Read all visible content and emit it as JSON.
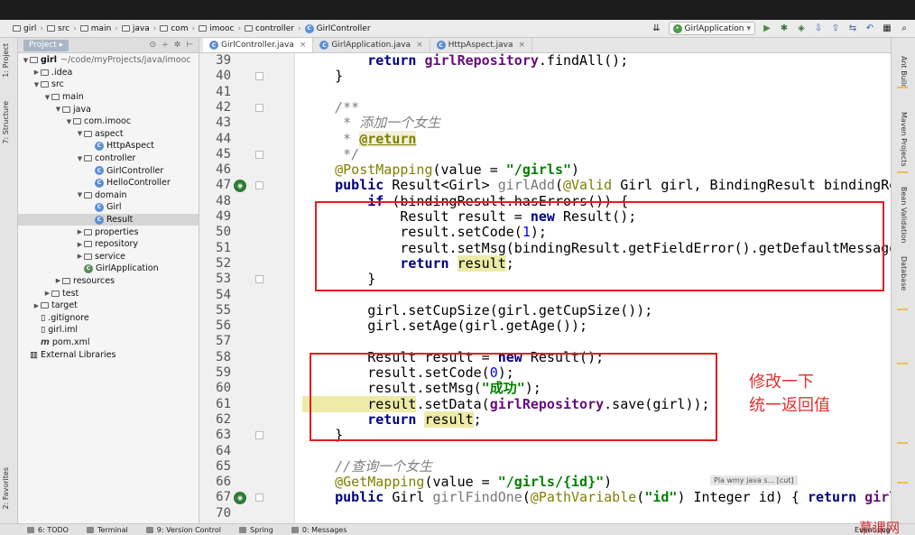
{
  "breadcrumb": [
    "girl",
    "src",
    "main",
    "java",
    "com",
    "imooc",
    "controller",
    "GirlController"
  ],
  "run_config": "GirlApplication",
  "project_panel": {
    "tab_label": "Project",
    "root_name": "girl",
    "root_path": "~/code/myProjects/java/imooc",
    "tree": [
      {
        "label": "girl",
        "type": "folder",
        "indent": 0
      },
      {
        "label": ".idea",
        "type": "folder",
        "indent": 1
      },
      {
        "label": "src",
        "type": "folder",
        "indent": 1
      },
      {
        "label": "main",
        "type": "folder",
        "indent": 2
      },
      {
        "label": "java",
        "type": "folder",
        "indent": 3
      },
      {
        "label": "com.imooc",
        "type": "package",
        "indent": 4
      },
      {
        "label": "aspect",
        "type": "package",
        "indent": 5
      },
      {
        "label": "HttpAspect",
        "type": "class",
        "indent": 6
      },
      {
        "label": "controller",
        "type": "package",
        "indent": 5
      },
      {
        "label": "GirlController",
        "type": "class",
        "indent": 6
      },
      {
        "label": "HelloController",
        "type": "class",
        "indent": 6
      },
      {
        "label": "domain",
        "type": "package",
        "indent": 5
      },
      {
        "label": "Girl",
        "type": "class",
        "indent": 6
      },
      {
        "label": "Result",
        "type": "class",
        "indent": 6,
        "selected": true
      },
      {
        "label": "properties",
        "type": "package",
        "indent": 5
      },
      {
        "label": "repository",
        "type": "package",
        "indent": 5
      },
      {
        "label": "service",
        "type": "package",
        "indent": 5
      },
      {
        "label": "GirlApplication",
        "type": "app",
        "indent": 5
      },
      {
        "label": "resources",
        "type": "folder",
        "indent": 3
      },
      {
        "label": "test",
        "type": "folder",
        "indent": 2
      },
      {
        "label": "target",
        "type": "folder",
        "indent": 1
      },
      {
        "label": ".gitignore",
        "type": "file",
        "indent": 1
      },
      {
        "label": "girl.iml",
        "type": "file",
        "indent": 1
      },
      {
        "label": "pom.xml",
        "type": "maven",
        "indent": 1
      },
      {
        "label": "External Libraries",
        "type": "lib",
        "indent": 0
      }
    ]
  },
  "editor_tabs": [
    {
      "label": "GirlController.java",
      "active": true
    },
    {
      "label": "GirlApplication.java",
      "active": false
    },
    {
      "label": "HttpAspect.java",
      "active": false
    }
  ],
  "code_lines": [
    {
      "n": "39",
      "tokens": [
        [
          "",
          "        "
        ],
        [
          "kw",
          "return "
        ],
        [
          "field",
          "girlRepository"
        ],
        [
          "",
          ".findAll();"
        ]
      ]
    },
    {
      "n": "40",
      "tokens": [
        [
          "",
          "    }"
        ]
      ]
    },
    {
      "n": "41",
      "tokens": [
        [
          "",
          ""
        ]
      ]
    },
    {
      "n": "42",
      "tokens": [
        [
          "comment",
          "    /**"
        ]
      ]
    },
    {
      "n": "43",
      "tokens": [
        [
          "comment",
          "     * 添加一个女生"
        ]
      ]
    },
    {
      "n": "44",
      "tokens": [
        [
          "comment",
          "     * "
        ],
        [
          "doc-tag",
          "@return"
        ]
      ]
    },
    {
      "n": "45",
      "tokens": [
        [
          "comment",
          "     */"
        ]
      ]
    },
    {
      "n": "46",
      "tokens": [
        [
          "ann",
          "    @PostMapping"
        ],
        [
          "",
          "(value = "
        ],
        [
          "str",
          "\"/girls\""
        ],
        [
          "",
          ")"
        ]
      ]
    },
    {
      "n": "47",
      "tokens": [
        [
          "kw",
          "    public "
        ],
        [
          "",
          "Result<Girl> "
        ],
        [
          "param",
          "girlAdd"
        ],
        [
          "",
          "("
        ],
        [
          "ann",
          "@Valid "
        ],
        [
          "",
          "Girl girl, BindingResult bindingResu"
        ]
      ]
    },
    {
      "n": "48",
      "tokens": [
        [
          "",
          "        "
        ],
        [
          "kw",
          "if "
        ],
        [
          "",
          "(bindingResult.hasErrors()) {"
        ]
      ]
    },
    {
      "n": "49",
      "tokens": [
        [
          "",
          "            Result result = "
        ],
        [
          "kw",
          "new "
        ],
        [
          "",
          "Result();"
        ]
      ]
    },
    {
      "n": "50",
      "tokens": [
        [
          "",
          "            result.setCode("
        ],
        [
          "num",
          "1"
        ],
        [
          "",
          ");"
        ]
      ]
    },
    {
      "n": "51",
      "tokens": [
        [
          "",
          "            result.setMsg(bindingResult.getFieldError().getDefaultMessage("
        ]
      ]
    },
    {
      "n": "52",
      "tokens": [
        [
          "",
          "            "
        ],
        [
          "kw",
          "return "
        ],
        [
          "hl",
          "result"
        ],
        [
          "",
          ";"
        ]
      ]
    },
    {
      "n": "53",
      "tokens": [
        [
          "",
          "        }"
        ]
      ]
    },
    {
      "n": "54",
      "tokens": [
        [
          "",
          ""
        ]
      ]
    },
    {
      "n": "55",
      "tokens": [
        [
          "",
          "        girl.setCupSize(girl.getCupSize());"
        ]
      ]
    },
    {
      "n": "56",
      "tokens": [
        [
          "",
          "        girl.setAge(girl.getAge());"
        ]
      ]
    },
    {
      "n": "57",
      "tokens": [
        [
          "",
          ""
        ]
      ]
    },
    {
      "n": "58",
      "tokens": [
        [
          "",
          "        Result result = "
        ],
        [
          "kw",
          "new "
        ],
        [
          "",
          "Result();"
        ]
      ]
    },
    {
      "n": "59",
      "tokens": [
        [
          "",
          "        result.setCode("
        ],
        [
          "num",
          "0"
        ],
        [
          "",
          ");"
        ]
      ]
    },
    {
      "n": "60",
      "tokens": [
        [
          "",
          "        result.setMsg("
        ],
        [
          "str",
          "\"成功\""
        ],
        [
          "",
          ");"
        ]
      ]
    },
    {
      "n": "61",
      "tokens": [
        [
          "hl",
          "        result"
        ],
        [
          "",
          ".setData("
        ],
        [
          "field",
          "girlRepository"
        ],
        [
          "",
          ".save(girl));"
        ]
      ]
    },
    {
      "n": "62",
      "tokens": [
        [
          "kw",
          "        return "
        ],
        [
          "hl",
          "result"
        ],
        [
          "",
          ";"
        ]
      ]
    },
    {
      "n": "63",
      "tokens": [
        [
          "",
          "    }"
        ]
      ]
    },
    {
      "n": "64",
      "tokens": [
        [
          "",
          ""
        ]
      ]
    },
    {
      "n": "65",
      "tokens": [
        [
          "comment",
          "    //查询一个女生"
        ]
      ]
    },
    {
      "n": "66",
      "tokens": [
        [
          "ann",
          "    @GetMapping"
        ],
        [
          "",
          "(value = "
        ],
        [
          "str",
          "\"/girls/{id}\""
        ],
        [
          "",
          ")"
        ]
      ]
    },
    {
      "n": "67",
      "tokens": [
        [
          "kw",
          "    public "
        ],
        [
          "",
          "Girl "
        ],
        [
          "param",
          "girlFindOne"
        ],
        [
          "",
          "("
        ],
        [
          "ann",
          "@PathVariable"
        ],
        [
          "",
          "("
        ],
        [
          "str",
          "\"id\""
        ],
        [
          "",
          ") Integer id) { "
        ],
        [
          "kw",
          "return "
        ],
        [
          "field",
          "girlR"
        ]
      ]
    },
    {
      "n": "70",
      "tokens": [
        [
          "",
          ""
        ]
      ]
    }
  ],
  "annotation_note": {
    "line1": "修改一下",
    "line2": "统一返回值"
  },
  "tooltip_text": "Pla wmy java s... [cut]",
  "left_tool_tabs": [
    "1: Project",
    "7: Structure",
    "2: Favorites"
  ],
  "right_tool_tabs": [
    "Ant Build",
    "Maven Projects",
    "Bean Validation",
    "Database"
  ],
  "status_items": [
    "6: TODO",
    "Terminal",
    "9: Version Control",
    "Spring",
    "0: Messages"
  ],
  "status_right": "Event Log",
  "watermark": "慕课网"
}
